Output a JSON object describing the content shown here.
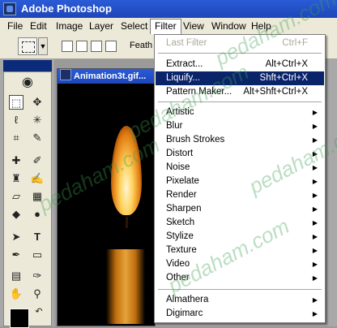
{
  "window": {
    "title": "Adobe Photoshop"
  },
  "menubar": [
    "File",
    "Edit",
    "Image",
    "Layer",
    "Select",
    "Filter",
    "View",
    "Window",
    "Help"
  ],
  "options_bar": {
    "feather_label": "Feath"
  },
  "document": {
    "title": "Animation3t.gif..."
  },
  "filter_menu": {
    "last_filter": {
      "label": "Last Filter",
      "shortcut": "Ctrl+F"
    },
    "extract": {
      "label": "Extract...",
      "shortcut": "Alt+Ctrl+X"
    },
    "liquify": {
      "label": "Liquify...",
      "shortcut": "Shft+Ctrl+X"
    },
    "pattern_maker": {
      "label": "Pattern Maker...",
      "shortcut": "Alt+Shft+Ctrl+X"
    },
    "submenus": [
      "Artistic",
      "Blur",
      "Brush Strokes",
      "Distort",
      "Noise",
      "Pixelate",
      "Render",
      "Sharpen",
      "Sketch",
      "Stylize",
      "Texture",
      "Video",
      "Other"
    ],
    "plugins": [
      "Almathera",
      "Digimarc"
    ]
  },
  "watermark": {
    "text": "pedaham.com"
  },
  "colors": {
    "title_bar": "#1d46b8",
    "highlight": "#0a246a",
    "menu_bg": "#ece9d8",
    "disabled_text": "#aca899"
  }
}
